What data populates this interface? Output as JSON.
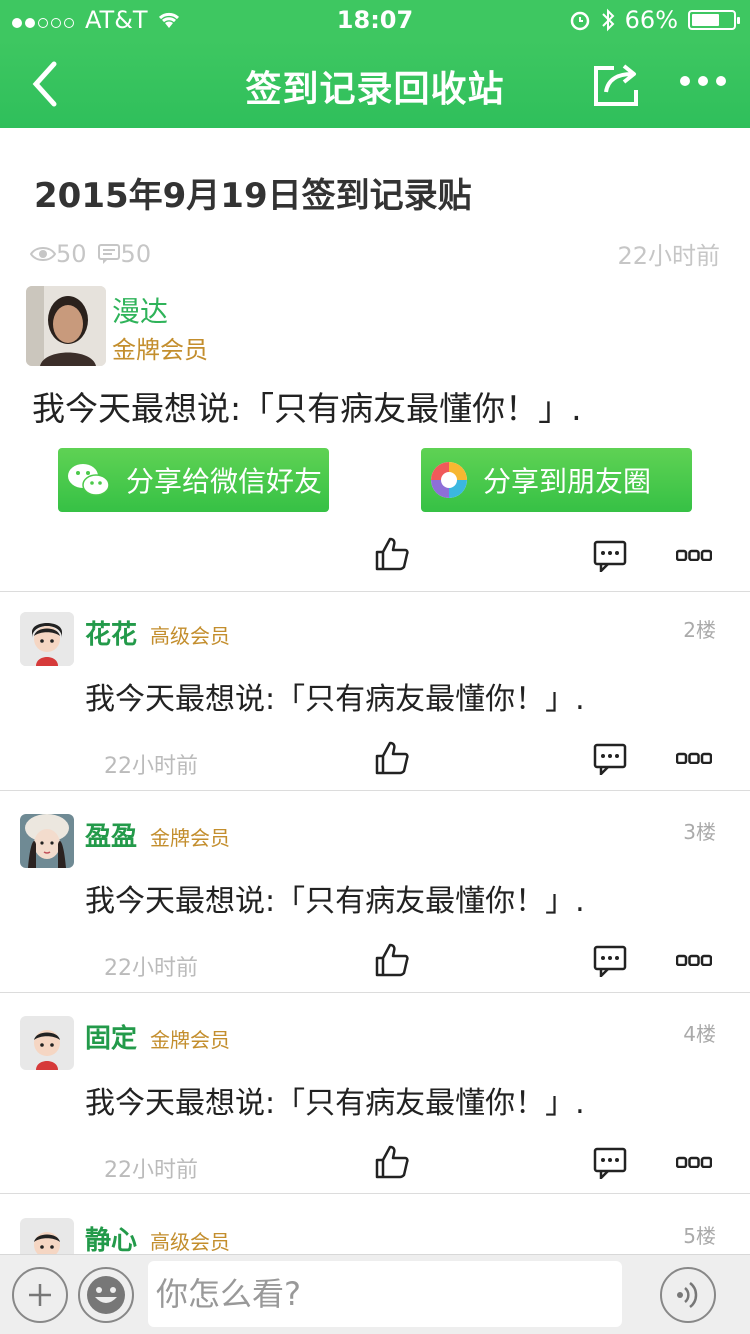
{
  "status": {
    "carrier": "AT&T",
    "time": "18:07",
    "battery": "66%",
    "battery_level": 0.66
  },
  "nav": {
    "title": "签到记录回收站"
  },
  "post": {
    "title": "2015年9月19日签到记录贴",
    "views": "50",
    "comments": "50",
    "time": "22小时前",
    "author": "漫达",
    "author_level": "金牌会员",
    "body": "我今天最想说:「只有病友最懂你！」."
  },
  "share": {
    "wechat": "分享给微信好友",
    "moments": "分享到朋友圈"
  },
  "replies": [
    {
      "name": "花花",
      "level": "高级会员",
      "floor": "2楼",
      "body": "我今天最想说:「只有病友最懂你！」.",
      "time": "22小时前"
    },
    {
      "name": "盈盈",
      "level": "金牌会员",
      "floor": "3楼",
      "body": "我今天最想说:「只有病友最懂你！」.",
      "time": "22小时前"
    },
    {
      "name": "固定",
      "level": "金牌会员",
      "floor": "4楼",
      "body": "我今天最想说:「只有病友最懂你！」.",
      "time": "22小时前"
    },
    {
      "name": "静心",
      "level": "高级会员",
      "floor": "5楼"
    }
  ],
  "input": {
    "placeholder": "你怎么看?"
  },
  "colors": {
    "brand": "#3ec761",
    "name_green": "#239a4a",
    "gold": "#c38e2d"
  }
}
